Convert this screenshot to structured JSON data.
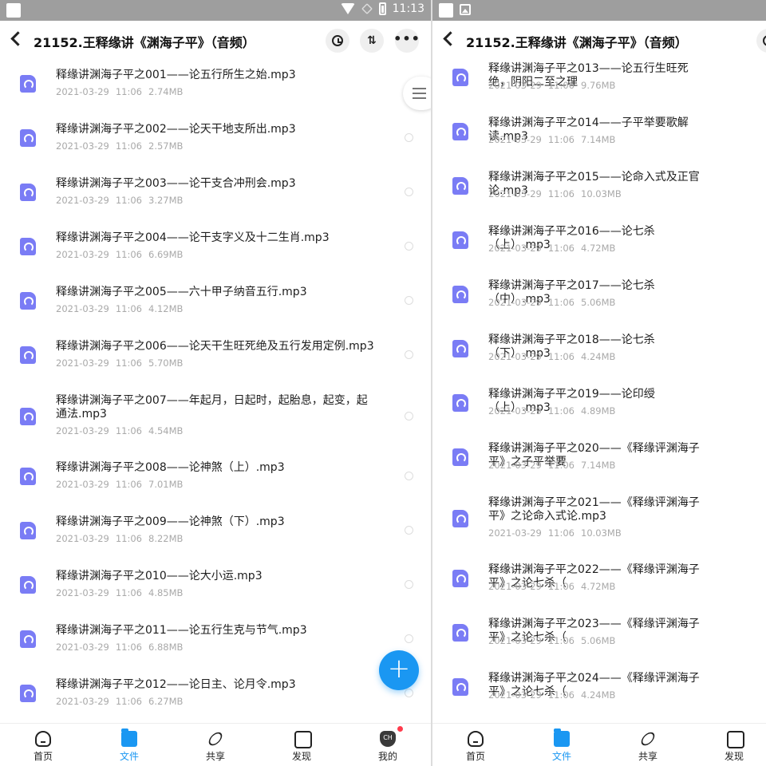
{
  "status": {
    "time": "11:13"
  },
  "header": {
    "title": "21152.王释缘讲《渊海子平》（音频）",
    "sort_icon": "⇅",
    "more_icon": "•••"
  },
  "left_files": [
    {
      "name": "释缘讲渊海子平之001——论五行所生之始.mp3",
      "date": "2021-03-29",
      "time": "11:06",
      "size": "2.74MB"
    },
    {
      "name": "释缘讲渊海子平之002——论天干地支所出.mp3",
      "date": "2021-03-29",
      "time": "11:06",
      "size": "2.57MB"
    },
    {
      "name": "释缘讲渊海子平之003——论干支合冲刑会.mp3",
      "date": "2021-03-29",
      "time": "11:06",
      "size": "3.27MB"
    },
    {
      "name": "释缘讲渊海子平之004——论干支字义及十二生肖.mp3",
      "date": "2021-03-29",
      "time": "11:06",
      "size": "6.69MB"
    },
    {
      "name": "释缘讲渊海子平之005——六十甲子纳音五行.mp3",
      "date": "2021-03-29",
      "time": "11:06",
      "size": "4.12MB"
    },
    {
      "name": "释缘讲渊海子平之006——论天干生旺死绝及五行发用定例.mp3",
      "date": "2021-03-29",
      "time": "11:06",
      "size": "5.70MB"
    },
    {
      "name": "释缘讲渊海子平之007——年起月，日起时，起胎息，起变，起通法.mp3",
      "date": "2021-03-29",
      "time": "11:06",
      "size": "4.54MB",
      "tall": true
    },
    {
      "name": "释缘讲渊海子平之008——论神煞（上）.mp3",
      "date": "2021-03-29",
      "time": "11:06",
      "size": "7.01MB"
    },
    {
      "name": "释缘讲渊海子平之009——论神煞（下）.mp3",
      "date": "2021-03-29",
      "time": "11:06",
      "size": "8.22MB"
    },
    {
      "name": "释缘讲渊海子平之010——论大小运.mp3",
      "date": "2021-03-29",
      "time": "11:06",
      "size": "4.85MB"
    },
    {
      "name": "释缘讲渊海子平之011——论五行生克与节气.mp3",
      "date": "2021-03-29",
      "time": "11:06",
      "size": "6.88MB"
    },
    {
      "name": "释缘讲渊海子平之012——论日主、论月令.mp3",
      "date": "2021-03-29",
      "time": "11:06",
      "size": "6.27MB"
    }
  ],
  "right_files": [
    {
      "name": "释缘讲渊海子平之013——论五行生旺死绝，阴阳二至之理",
      "date": "2021-03-29",
      "time": "11:06",
      "size": "9.76MB"
    },
    {
      "name": "释缘讲渊海子平之014——子平举要歌解读.mp3",
      "date": "2021-03-29",
      "time": "11:06",
      "size": "7.14MB"
    },
    {
      "name": "释缘讲渊海子平之015——论命入式及正官论.mp3",
      "date": "2021-03-29",
      "time": "11:06",
      "size": "10.03MB"
    },
    {
      "name": "释缘讲渊海子平之016——论七杀（上）.mp3",
      "date": "2021-03-29",
      "time": "11:06",
      "size": "4.72MB"
    },
    {
      "name": "释缘讲渊海子平之017——论七杀（中）.mp3",
      "date": "2021-03-29",
      "time": "11:06",
      "size": "5.06MB"
    },
    {
      "name": "释缘讲渊海子平之018——论七杀（下）.mp3",
      "date": "2021-03-29",
      "time": "11:06",
      "size": "4.24MB"
    },
    {
      "name": "释缘讲渊海子平之019——论印绶（上）.mp3",
      "date": "2021-03-29",
      "time": "11:06",
      "size": "4.89MB"
    },
    {
      "name": "释缘讲渊海子平之020——《释缘评渊海子平》之子平举要",
      "date": "2021-03-29",
      "time": "11:06",
      "size": "7.14MB"
    },
    {
      "name": "释缘讲渊海子平之021——《释缘评渊海子平》之论命入式论.mp3",
      "date": "2021-03-29",
      "time": "11:06",
      "size": "10.03MB",
      "tall": true
    },
    {
      "name": "释缘讲渊海子平之022——《释缘评渊海子平》之论七杀（",
      "date": "2021-03-29",
      "time": "11:06",
      "size": "4.72MB"
    },
    {
      "name": "释缘讲渊海子平之023——《释缘评渊海子平》之论七杀（",
      "date": "2021-03-29",
      "time": "11:06",
      "size": "5.06MB"
    },
    {
      "name": "释缘讲渊海子平之024——《释缘评渊海子平》之论七杀（",
      "date": "2021-03-29",
      "time": "11:06",
      "size": "4.24MB"
    }
  ],
  "tabs": [
    {
      "label": "首页",
      "icon": "home-icon"
    },
    {
      "label": "文件",
      "icon": "folder-icon",
      "active": true
    },
    {
      "label": "共享",
      "icon": "share-icon"
    },
    {
      "label": "发现",
      "icon": "discover-icon"
    },
    {
      "label": "我的",
      "icon": "profile-icon"
    }
  ],
  "fab": {
    "label": "+"
  },
  "me_badge_text": "CH",
  "colors": {
    "accent": "#1a97f2",
    "file_icon": "#7a7cf5",
    "badge": "#ff3b4c"
  }
}
